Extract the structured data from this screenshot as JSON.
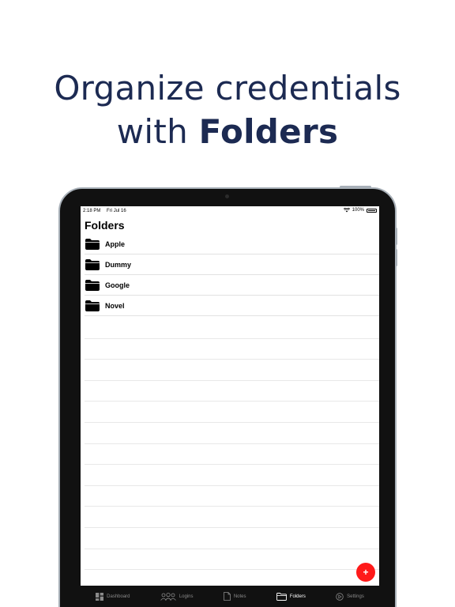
{
  "headline": {
    "line1": "Organize credentials",
    "line2_prefix": "with ",
    "line2_bold": "Folders"
  },
  "status_bar": {
    "time": "2:18 PM",
    "date": "Fri Jul 16",
    "battery": "100%"
  },
  "screen": {
    "title": "Folders",
    "folders": [
      {
        "label": "Apple",
        "icon": "folder-icon"
      },
      {
        "label": "Dummy",
        "icon": "folder-icon"
      },
      {
        "label": "Google",
        "icon": "folder-icon"
      },
      {
        "label": "Novel",
        "icon": "folder-icon"
      }
    ],
    "add_button_label": "+"
  },
  "tab_bar": {
    "tabs": [
      {
        "label": "Dashboard",
        "icon": "dashboard-icon",
        "active": false
      },
      {
        "label": "Logins",
        "icon": "users-icon",
        "active": false
      },
      {
        "label": "Notes",
        "icon": "note-icon",
        "active": false
      },
      {
        "label": "Folders",
        "icon": "folder-icon",
        "active": true
      },
      {
        "label": "Settings",
        "icon": "settings-icon",
        "active": false
      }
    ]
  },
  "colors": {
    "headline": "#1c2a52",
    "fab": "#ff1a1a",
    "tab_bar": "#111111"
  }
}
